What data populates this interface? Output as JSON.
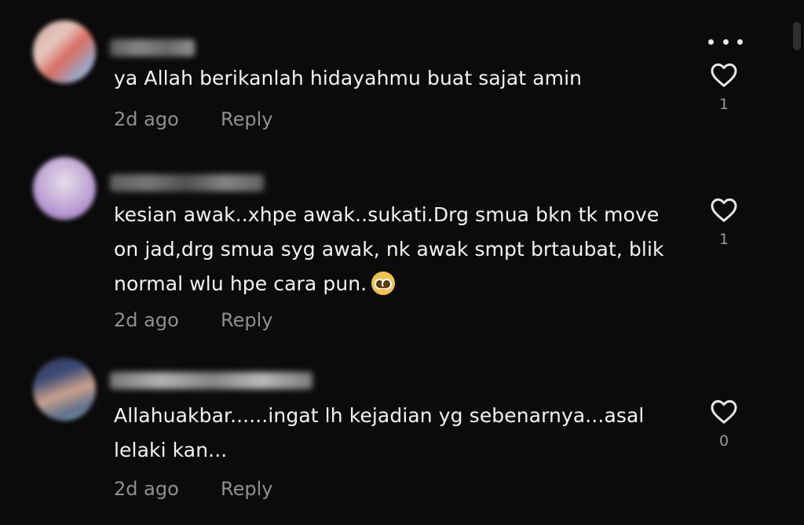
{
  "comments": [
    {
      "text": "ya Allah berikanlah hidayahmu buat sajat amin",
      "time": "2d ago",
      "reply_label": "Reply",
      "likes": "1",
      "emoji": ""
    },
    {
      "text": "kesian awak..xhpe awak..sukati.Drg smua bkn tk move on jad,drg smua syg awak, nk awak smpt brtaubat, blik normal wlu hpe cara pun.",
      "time": "2d ago",
      "reply_label": "Reply",
      "likes": "1",
      "emoji": "pleading-face-emoji"
    },
    {
      "text": "Allahuakbar......ingat lh kejadian yg sebenarnya...asal lelaki kan...",
      "time": "2d ago",
      "reply_label": "Reply",
      "likes": "0",
      "emoji": ""
    }
  ],
  "icons": {
    "more": "more-options-icon",
    "like": "heart-outline-icon"
  },
  "colors": {
    "background": "#0b0b0b",
    "text": "#f3f3f3",
    "meta": "#8f8f8f"
  }
}
